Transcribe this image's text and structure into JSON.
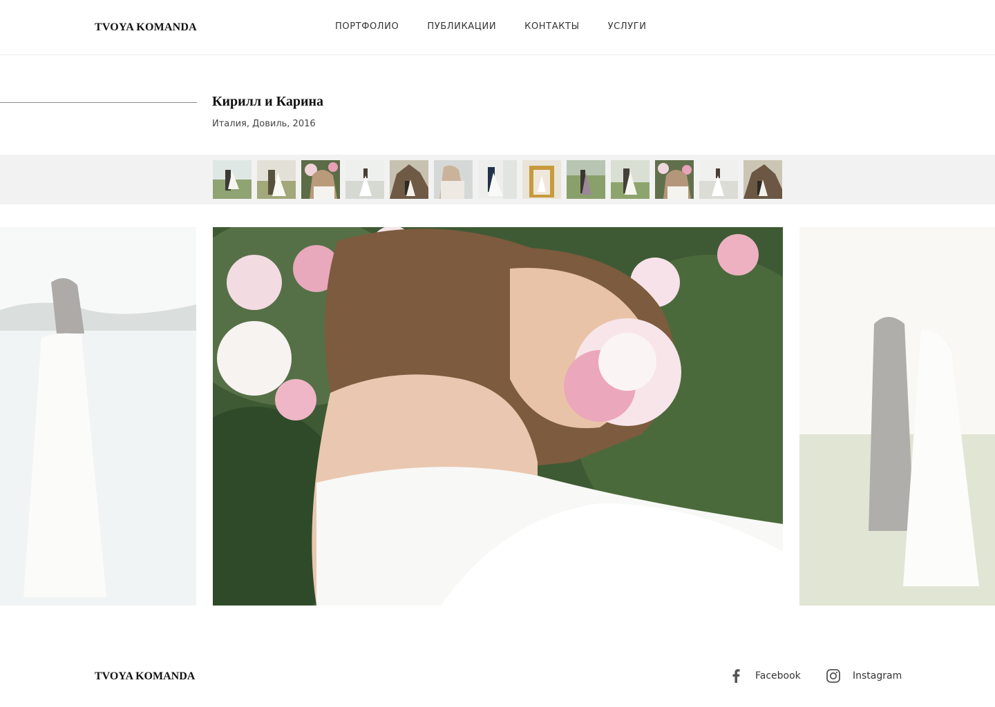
{
  "header": {
    "logo": "TVOYA KOMANDA",
    "nav": [
      {
        "label": "ПОРТФОЛИО"
      },
      {
        "label": "ПУБЛИКАЦИИ"
      },
      {
        "label": "КОНТАКТЫ"
      },
      {
        "label": "УСЛУГИ"
      }
    ]
  },
  "gallery": {
    "title": "Кирилл и Карина",
    "subtitle": "Италия, Довиль, 2016"
  },
  "footer": {
    "logo": "TVOYA KOMANDA",
    "social": [
      {
        "label": "Facebook",
        "icon": "facebook-icon"
      },
      {
        "label": "Instagram",
        "icon": "instagram-icon"
      }
    ]
  },
  "colors": {
    "thumb_strip_bg": "#f2f2f2",
    "divider": "#8a8a8a",
    "text": "#1a1a1a"
  }
}
